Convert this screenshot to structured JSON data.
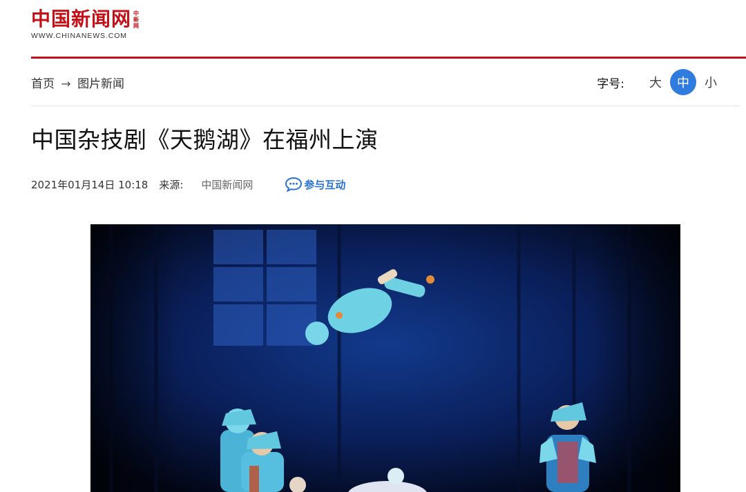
{
  "logo": {
    "name_cn": "中国新闻网",
    "tag": "中新网",
    "domain": "WWW.CHINANEWS.COM"
  },
  "breadcrumb": {
    "home": "首页",
    "separator": "→",
    "section": "图片新闻"
  },
  "font_size_control": {
    "label": "字号:",
    "options": [
      "大",
      "中",
      "小"
    ],
    "selected": "中"
  },
  "article": {
    "title": "中国杂技剧《天鹅湖》在福州上演",
    "datetime": "2021年01月14日 10:18",
    "source_label": "来源:",
    "source": "中国新闻网",
    "interact_label": "参与互动"
  },
  "colors": {
    "brand_red": "#c4111b",
    "accent_blue": "#2f7bde",
    "link_blue": "#2a72d4"
  },
  "icons": {
    "comment_bubble": "chat-bubble-icon"
  }
}
